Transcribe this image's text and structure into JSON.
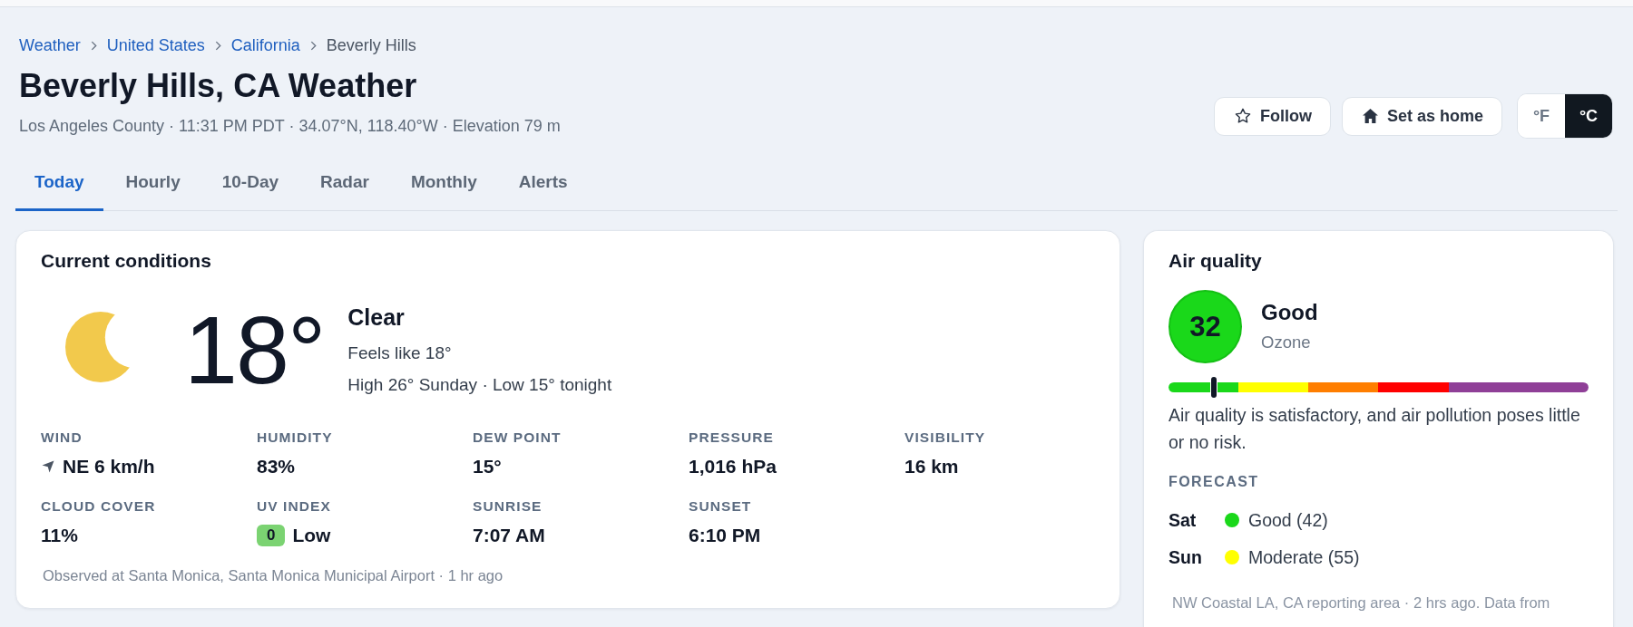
{
  "breadcrumb": [
    {
      "label": "Weather",
      "current": false
    },
    {
      "label": "United States",
      "current": false
    },
    {
      "label": "California",
      "current": false
    },
    {
      "label": "Beverly Hills",
      "current": true
    }
  ],
  "title": "Beverly Hills, CA Weather",
  "location_details": "Los Angeles County · 11:31 PM PDT · 34.07°N, 118.40°W · Elevation 79 m",
  "actions": [
    {
      "label": "Follow",
      "kind": "follow"
    },
    {
      "label": "Set as home",
      "kind": "home"
    }
  ],
  "units": [
    {
      "label": "°F",
      "selected": false
    },
    {
      "label": "°C",
      "selected": true
    }
  ],
  "tabs": [
    {
      "label": "Today",
      "selected": true
    },
    {
      "label": "Hourly",
      "selected": false
    },
    {
      "label": "10-Day",
      "selected": false
    },
    {
      "label": "Radar",
      "selected": false
    },
    {
      "label": "Monthly",
      "selected": false
    },
    {
      "label": "Alerts",
      "selected": false
    }
  ],
  "current_conditions": {
    "title": "Current conditions",
    "temperature": "18°",
    "condition": "Clear",
    "feels_like": "Feels like 18°",
    "high_low": "High 26° Sunday · Low 15° tonight",
    "stats": [
      {
        "label": "WIND",
        "value": "NE 6 km/h",
        "kind": "wind"
      },
      {
        "label": "HUMIDITY",
        "value": "83%",
        "kind": "plain"
      },
      {
        "label": "DEW POINT",
        "value": "15°",
        "kind": "plain"
      },
      {
        "label": "PRESSURE",
        "value": "1,016 hPa",
        "kind": "plain"
      },
      {
        "label": "VISIBILITY",
        "value": "16 km",
        "kind": "plain"
      },
      {
        "label": "CLOUD COVER",
        "value": "11%",
        "kind": "plain"
      },
      {
        "label": "UV INDEX",
        "value": "Low",
        "badge": "0",
        "kind": "uv"
      },
      {
        "label": "SUNRISE",
        "value": "7:07 AM",
        "kind": "plain"
      },
      {
        "label": "SUNSET",
        "value": "6:10 PM",
        "kind": "plain"
      }
    ],
    "observed": "Observed at Santa Monica, Santa Monica Municipal Airport · 1 hr ago"
  },
  "air_quality": {
    "title": "Air quality",
    "aqi": "32",
    "category": "Good",
    "pollutant": "Ozone",
    "level": 0.107,
    "description": "Air quality is satisfactory, and air pollution poses little or no risk.",
    "forecast_heading": "FORECAST",
    "forecast": [
      {
        "day": "Sat",
        "label": "Good (42)",
        "color": "#1ad81a"
      },
      {
        "day": "Sun",
        "label": "Moderate (55)",
        "color": "#ffff00"
      }
    ],
    "source": "NW Coastal LA, CA reporting area · 2 hrs ago. Data from"
  }
}
